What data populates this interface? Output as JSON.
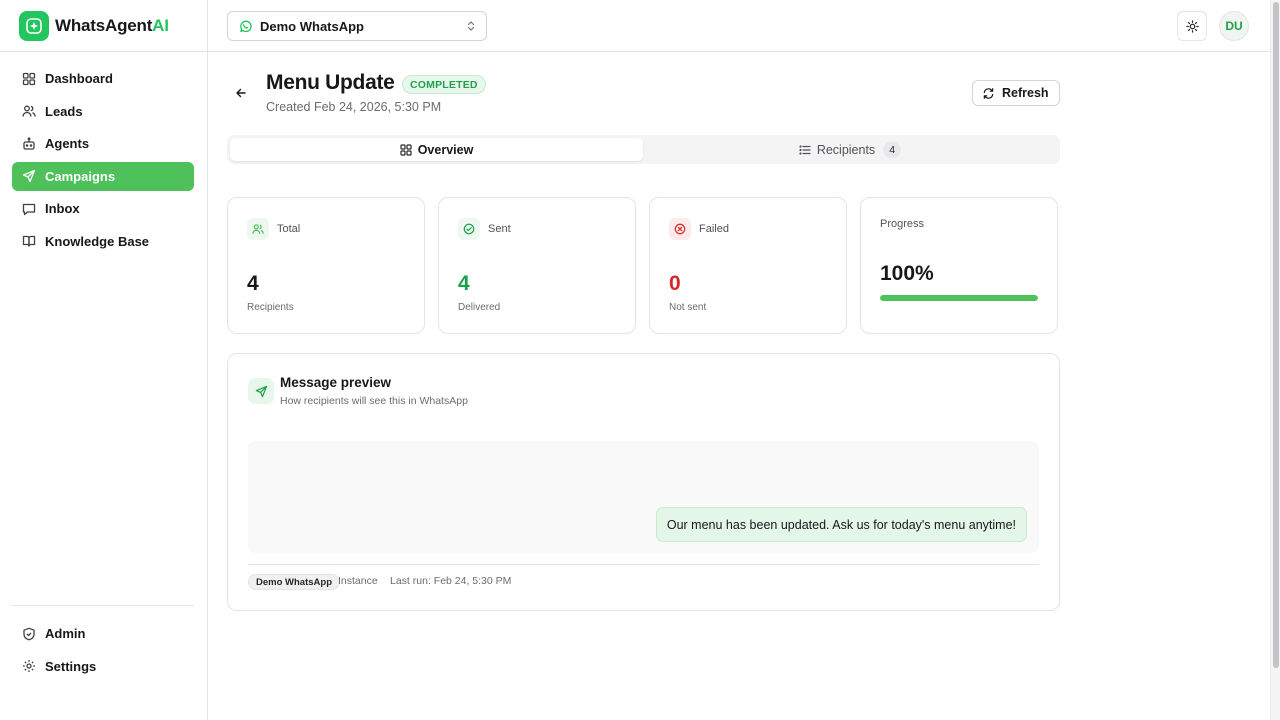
{
  "brand": {
    "name_main": "WhatsAgent",
    "name_accent": "AI",
    "accent_color": "#22c55e"
  },
  "sidebar": {
    "items": [
      {
        "label": "Dashboard",
        "icon": "dashboard-icon"
      },
      {
        "label": "Leads",
        "icon": "users-icon"
      },
      {
        "label": "Agents",
        "icon": "bot-icon"
      },
      {
        "label": "Campaigns",
        "icon": "send-icon",
        "active": true
      },
      {
        "label": "Inbox",
        "icon": "message-icon"
      },
      {
        "label": "Knowledge Base",
        "icon": "book-icon"
      }
    ],
    "bottom_items": [
      {
        "label": "Admin",
        "icon": "shield-icon"
      },
      {
        "label": "Settings",
        "icon": "gear-icon"
      }
    ]
  },
  "topbar": {
    "instance": "Demo WhatsApp",
    "avatar": "DU"
  },
  "header": {
    "title": "Menu Update",
    "status": "COMPLETED",
    "created": "Created Feb 24, 2026, 5:30 PM",
    "refresh_label": "Refresh"
  },
  "tabs": {
    "overview": "Overview",
    "recipients": "Recipients",
    "recipients_count": "4"
  },
  "stats": {
    "total": {
      "label": "Total",
      "value": "4",
      "sub": "Recipients"
    },
    "sent": {
      "label": "Sent",
      "value": "4",
      "sub": "Delivered",
      "color": "#16a34a"
    },
    "failed": {
      "label": "Failed",
      "value": "0",
      "sub": "Not sent",
      "color": "#dc2626"
    },
    "progress": {
      "label": "Progress",
      "value": "100%",
      "fraction": 1.0
    }
  },
  "preview": {
    "title": "Message preview",
    "subtitle": "How recipients will see this in WhatsApp",
    "message": "Our menu has been updated. Ask us for today's menu anytime!",
    "instance_chip": "Demo WhatsApp",
    "instance_label": "Instance",
    "last_run": "Last run: Feb 24, 5:30 PM"
  }
}
